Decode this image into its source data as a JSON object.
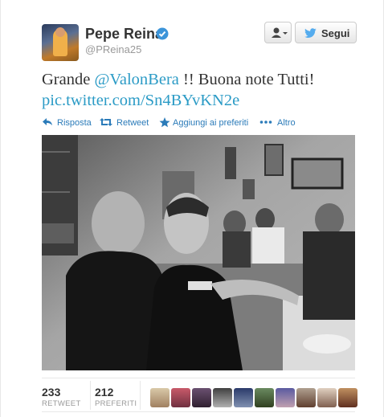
{
  "user": {
    "name": "Pepe Reina",
    "handle": "@PReina25"
  },
  "header": {
    "follow_label": "Segui"
  },
  "tweet": {
    "text_before": "Grande ",
    "mention": "@ValonBera",
    "text_after": " !! Buona note Tutti!",
    "link": "pic.twitter.com/Sn4BYvKN2e"
  },
  "actions": {
    "reply": "Risposta",
    "retweet": "Retweet",
    "favorite": "Aggiungi ai preferiti",
    "more": "Altro"
  },
  "stats": {
    "retweets_count": "233",
    "retweets_label": "RETWEET",
    "favorites_count": "212",
    "favorites_label": "PREFERITI"
  },
  "colors": {
    "link": "#2b9bc6",
    "action": "#2b7bb9",
    "verified": "#3b94d9"
  },
  "icons": [
    "verified-badge-icon",
    "user-dropdown-icon",
    "twitter-bird-icon",
    "reply-icon",
    "retweet-icon",
    "star-icon",
    "more-dots-icon"
  ]
}
